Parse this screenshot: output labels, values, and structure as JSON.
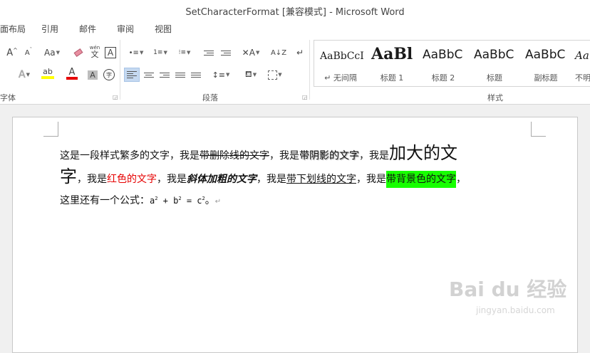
{
  "window": {
    "title": "SetCharacterFormat [兼容模式] - Microsoft Word"
  },
  "tabs": [
    {
      "label": "面布局"
    },
    {
      "label": "引用"
    },
    {
      "label": "邮件"
    },
    {
      "label": "审阅"
    },
    {
      "label": "视图"
    }
  ],
  "ribbon": {
    "font_group_label": "字体",
    "paragraph_group_label": "段落",
    "styles_group_label": "样式",
    "font": {
      "grow": "A",
      "shrink": "A",
      "change_case": "Aa",
      "phonetic_top": "wén",
      "phonetic_bottom": "文",
      "char_border": "A",
      "text_effects": "A",
      "highlight": "ab",
      "font_color": "A",
      "char_shading": "A",
      "enclose": "字",
      "highlight_color": "#ffff00",
      "font_color_value": "#e60000"
    },
    "styles": [
      {
        "preview": "AaBbCcI",
        "name": "↵ 无间隔"
      },
      {
        "preview": "AaBl",
        "name": "标题 1"
      },
      {
        "preview": "AaBbC",
        "name": "标题 2"
      },
      {
        "preview": "AaBbC",
        "name": "标题"
      },
      {
        "preview": "AaBbC",
        "name": "副标题"
      },
      {
        "preview": "Aa",
        "name": "不明"
      }
    ]
  },
  "document": {
    "line1_a": "这是一段样式繁多的文字，我是",
    "line1_strike": "带删除线的文字",
    "line1_b": "，我是",
    "line1_shadow": "带阴影的文字",
    "line1_c": "，我是",
    "line1_big": "加大的文",
    "line2_big": "字",
    "line2_a": "，我是",
    "line2_red": "红色的文字",
    "line2_b": "，我是",
    "line2_bi": "斜体加粗的文字",
    "line2_c": "，我是",
    "line2_ul": "带下划线的文字",
    "line2_d": "，我是",
    "line2_hl": "带背景色的文字",
    "line2_e": "，",
    "line3_a": "这里还有一个公式：",
    "formula_a": "a",
    "formula_exp": "2",
    "formula_plus": " + ",
    "formula_b": "b",
    "formula_eq": " = ",
    "formula_c": "c",
    "line3_end": "。",
    "para_mark": "↵",
    "highlight_color": "#17ff00",
    "red_color": "#e60000"
  },
  "watermark": {
    "main": "Bai du 经验",
    "sub": "jingyan.baidu.com"
  }
}
